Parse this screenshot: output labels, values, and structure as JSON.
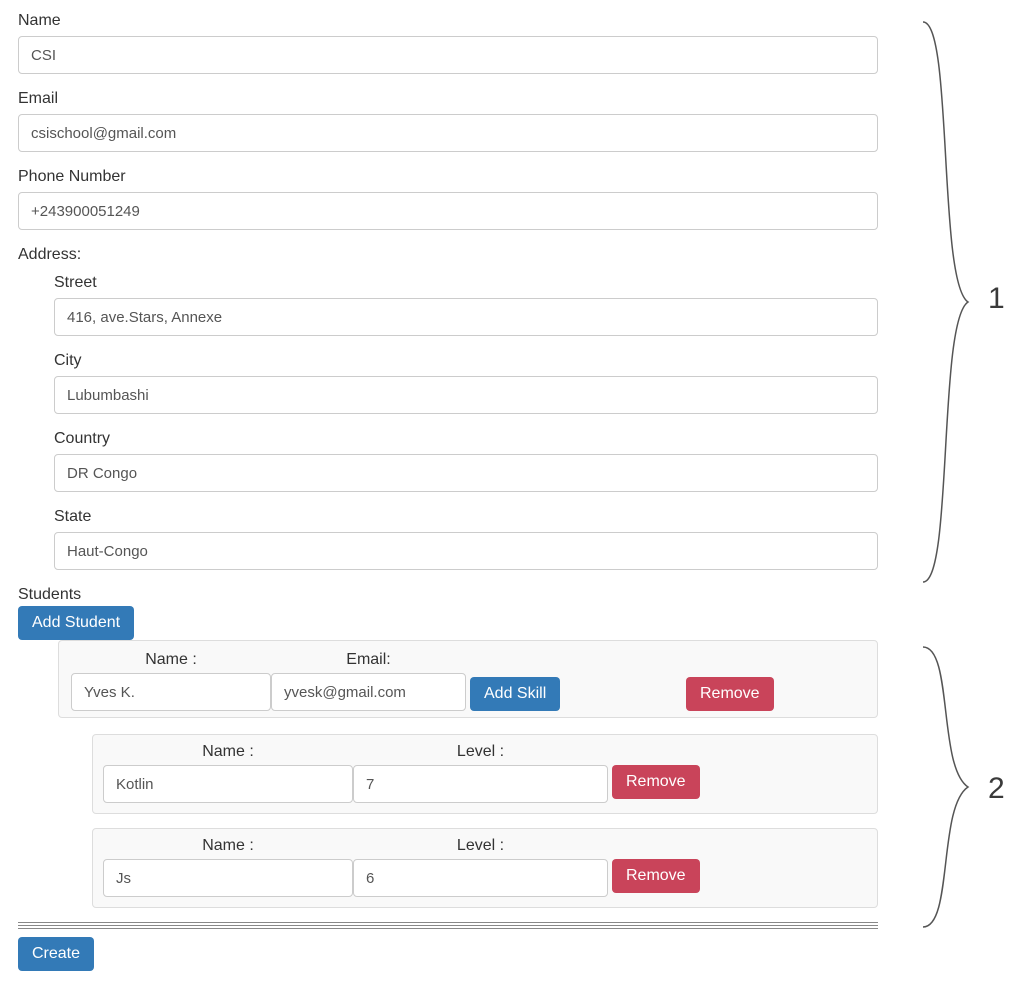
{
  "labels": {
    "name": "Name",
    "email": "Email",
    "phone": "Phone Number",
    "address": "Address:",
    "street": "Street",
    "city": "City",
    "country": "Country",
    "state": "State",
    "students": "Students"
  },
  "values": {
    "name": "CSI",
    "email": "csischool@gmail.com",
    "phone": "+243900051249",
    "street": "416, ave.Stars, Annexe",
    "city": "Lubumbashi",
    "country": "DR Congo",
    "state": "Haut-Congo"
  },
  "buttons": {
    "add_student": "Add Student",
    "add_skill": "Add Skill",
    "remove": "Remove",
    "create": "Create"
  },
  "student_headers": {
    "name": "Name :",
    "email": "Email:"
  },
  "skill_headers": {
    "name": "Name :",
    "level": "Level :"
  },
  "students": [
    {
      "name": "Yves K.",
      "email": "yvesk@gmail.com",
      "skills": [
        {
          "name": "Kotlin",
          "level": "7"
        },
        {
          "name": "Js",
          "level": "6"
        }
      ]
    }
  ],
  "annotations": {
    "brace1": "1",
    "brace2": "2"
  }
}
